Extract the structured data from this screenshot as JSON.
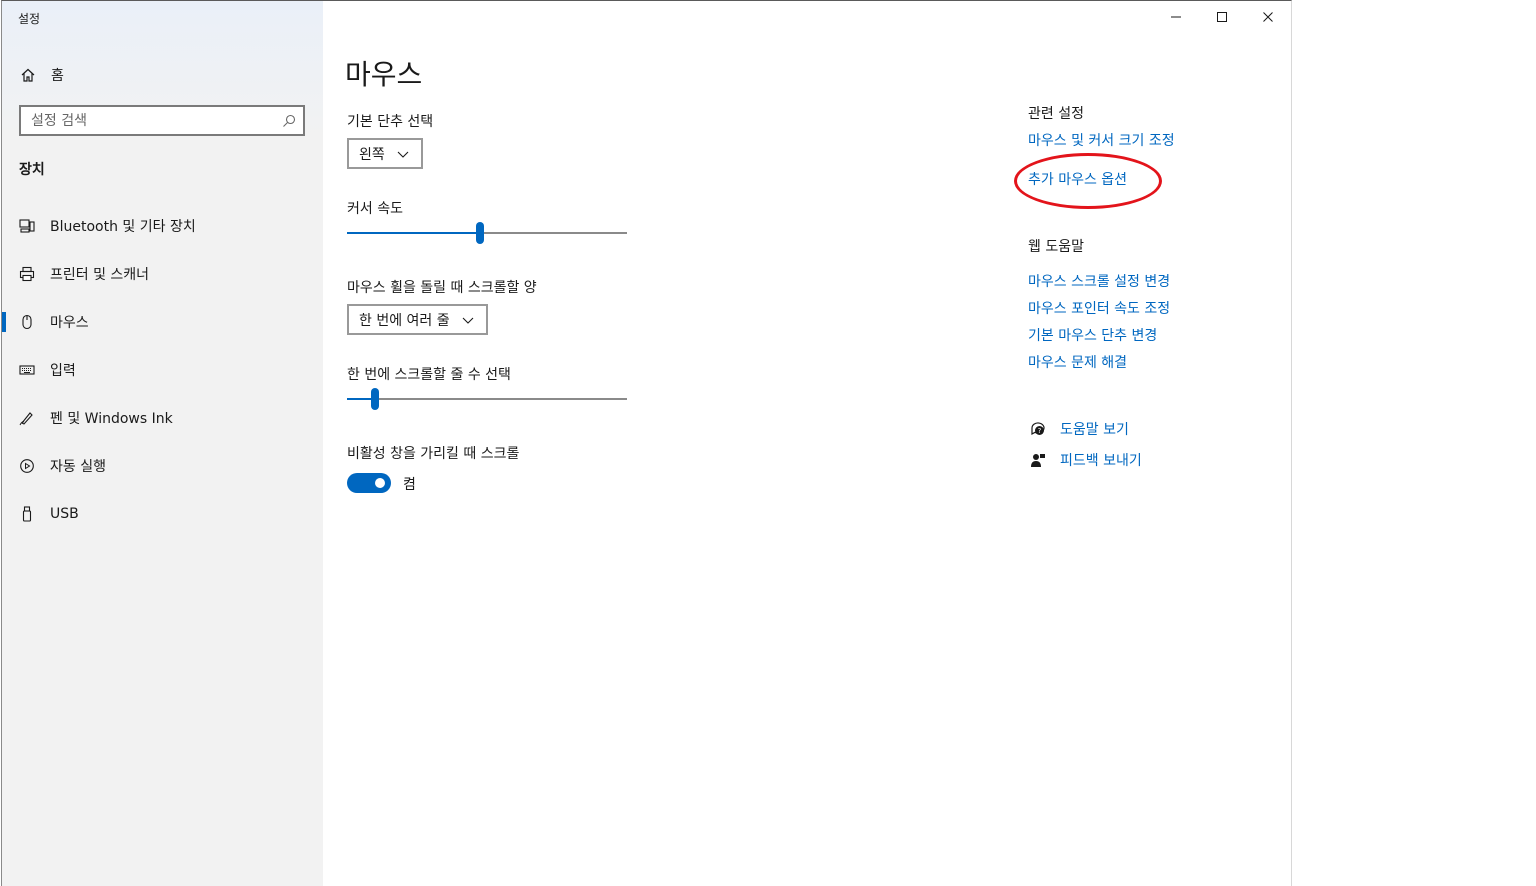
{
  "window": {
    "title": "설정"
  },
  "sidebar": {
    "home_label": "홈",
    "search_placeholder": "설정 검색",
    "section_title": "장치",
    "items": [
      {
        "label": "Bluetooth 및 기타 장치",
        "icon": "bluetooth-devices-icon"
      },
      {
        "label": "프린터 및 스캐너",
        "icon": "printer-icon"
      },
      {
        "label": "마우스",
        "icon": "mouse-icon",
        "active": true
      },
      {
        "label": "입력",
        "icon": "keyboard-icon"
      },
      {
        "label": "펜 및 Windows Ink",
        "icon": "pen-icon"
      },
      {
        "label": "자동 실행",
        "icon": "autoplay-icon"
      },
      {
        "label": "USB",
        "icon": "usb-icon"
      }
    ]
  },
  "main": {
    "title": "마우스",
    "primary_button": {
      "label": "기본 단추 선택",
      "value": "왼쪽"
    },
    "cursor_speed": {
      "label": "커서 속도",
      "value_percent": 47.5
    },
    "scroll_amount": {
      "label": "마우스 휠을 돌릴 때 스크롤할 양",
      "value": "한 번에 여러 줄"
    },
    "scroll_lines": {
      "label": "한 번에 스크롤할 줄 수 선택",
      "value_percent": 10
    },
    "inactive_scroll": {
      "label": "비활성 창을 가리킬 때 스크롤",
      "state": "켬",
      "on": true
    }
  },
  "related": {
    "heading": "관련 설정",
    "links": [
      "마우스 및 커서 크기 조정",
      "추가 마우스 옵션"
    ],
    "web_help_heading": "웹 도움말",
    "web_links": [
      "마우스 스크롤 설정 변경",
      "마우스 포인터 속도 조정",
      "기본 마우스 단추 변경",
      "마우스 문제 해결"
    ],
    "help": {
      "label": "도움말 보기",
      "icon": "help-chat-icon"
    },
    "feedback": {
      "label": "피드백 보내기",
      "icon": "feedback-icon"
    }
  },
  "colors": {
    "accent": "#0067c0",
    "annotation": "#e3141b",
    "sidebar_bg": "#f2f2f2"
  }
}
